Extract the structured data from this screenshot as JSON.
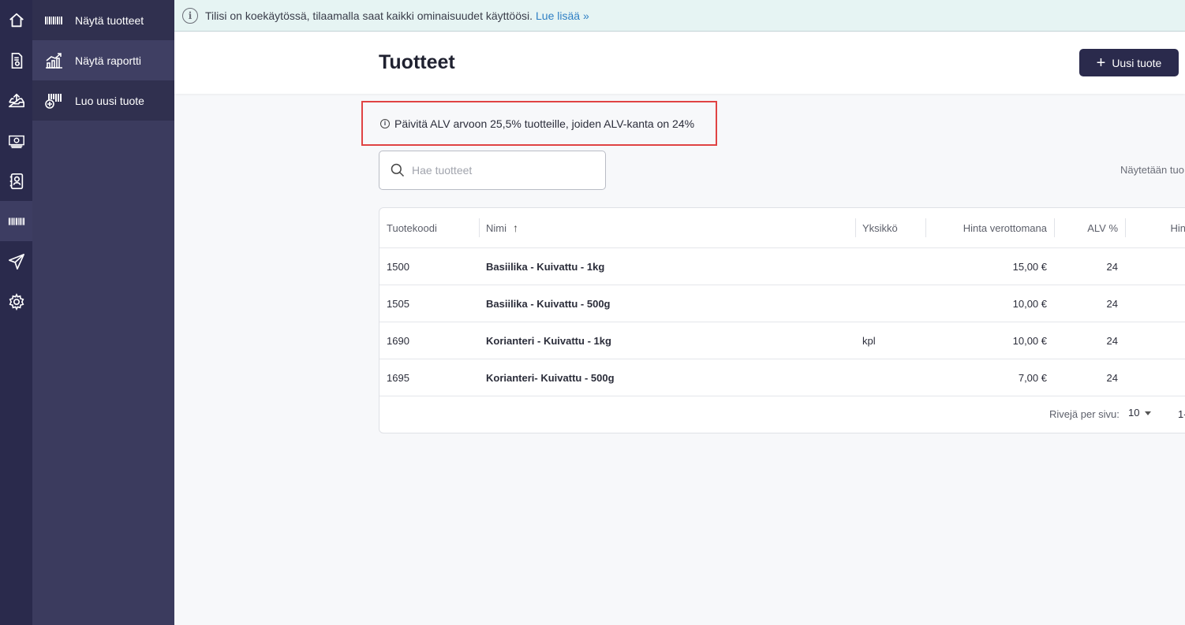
{
  "rail": {
    "items": [
      {
        "icon": "home-icon"
      },
      {
        "icon": "invoice-icon"
      },
      {
        "icon": "inbox-upload-icon"
      },
      {
        "icon": "money-icon"
      },
      {
        "icon": "contacts-icon"
      },
      {
        "icon": "barcode-icon",
        "active": true
      },
      {
        "icon": "send-icon"
      },
      {
        "icon": "settings-icon"
      }
    ]
  },
  "subnav": {
    "items": [
      {
        "label": "Näytä tuotteet",
        "icon": "barcode-icon"
      },
      {
        "label": "Näytä raportti",
        "icon": "chart-icon",
        "active": true
      },
      {
        "label": "Luo uusi tuote",
        "icon": "add-product-icon"
      }
    ]
  },
  "banner": {
    "text": "Tilisi on koekäytössä, tilaamalla saat kaikki ominaisuudet käyttöösi.",
    "link": "Lue lisää »"
  },
  "header": {
    "title": "Tuotteet",
    "new_button": "Uusi tuote"
  },
  "notice": {
    "text": "Päivitä ALV arvoon 25,5% tuotteille, joiden ALV-kanta on 24%"
  },
  "search": {
    "placeholder": "Hae tuotteet"
  },
  "showing_text": "Näytetään tuo",
  "table": {
    "headers": {
      "code": "Tuotekoodi",
      "name": "Nimi",
      "unit": "Yksikkö",
      "price": "Hinta verottomana",
      "vat": "ALV %",
      "gross": "Hin"
    },
    "rows": [
      {
        "code": "1500",
        "name": "Basiilika - Kuivattu - 1kg",
        "unit": "",
        "price": "15,00 €",
        "vat": "24"
      },
      {
        "code": "1505",
        "name": "Basiilika - Kuivattu - 500g",
        "unit": "",
        "price": "10,00 €",
        "vat": "24"
      },
      {
        "code": "1690",
        "name": "Korianteri - Kuivattu - 1kg",
        "unit": "kpl",
        "price": "10,00 €",
        "vat": "24"
      },
      {
        "code": "1695",
        "name": "Korianteri- Kuivattu - 500g",
        "unit": "",
        "price": "7,00 €",
        "vat": "24"
      }
    ],
    "footer": {
      "rows_per_page_label": "Rivejä per sivu:",
      "rows_per_page_value": "10",
      "range": "1-"
    }
  }
}
